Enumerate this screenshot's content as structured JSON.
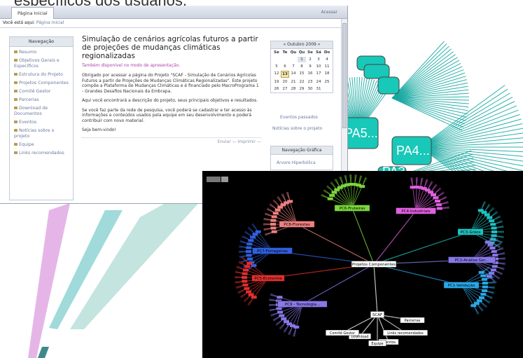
{
  "slide": {
    "title_fragment": "específicos dos usuários."
  },
  "background": {
    "page_labels": [
      "PA5...",
      "PA4...",
      "PA3"
    ]
  },
  "browser": {
    "tab_label": "Página Inicial",
    "access_link": "Acessar",
    "breadcrumb_prefix": "Você está aqui:",
    "breadcrumb_link": "Página Inicial"
  },
  "navigation": {
    "heading": "Navegação",
    "items": [
      {
        "label": "Resumo"
      },
      {
        "label": "Objetivos Gerais e Específicos"
      },
      {
        "label": "Estrutura do Projeto"
      },
      {
        "label": "Projetos Componentes"
      },
      {
        "label": "Comitê Gestor"
      },
      {
        "label": "Parcerias"
      },
      {
        "label": "Download de Documentos"
      },
      {
        "label": "Eventos"
      },
      {
        "label": "Notícias sobre o projeto"
      },
      {
        "label": "Equipe"
      },
      {
        "label": "Links recomendados"
      }
    ]
  },
  "main": {
    "title": "Simulação de cenários agrícolas futuros a partir de projeções de mudanças climáticas regionalizadas",
    "alt_mode": "Também disponível no modo de apresentação.",
    "paragraphs": [
      "Obrigado por acessar a página do Projeto \"SCAF - Simulação de Cenários Agrícolas Futuros a partir de Projeções de Mudanças Climáticas Regionalizadas\". Este projeto compõe a Plataforma de Mudanças Climáticas e é financiado pelo MacroPrograma 1 - Grandes Desafios Nacionais da Embrapa.",
      "Aqui você encontrará a descrição do projeto, seus principais objetivos e resultados.",
      "Se você faz parte da rede de pesquisa, você poderá se cadastrar e ter acesso às informações e conteúdos usados pela equipe em seu desenvolvimento e poderá contribuir com novo material.",
      "Seja bem-vindo!"
    ],
    "send_label": "Enviar",
    "print_label": "Imprimir"
  },
  "calendar": {
    "prev": "«",
    "next": "»",
    "month_label": "Outubro 2009",
    "weekdays": [
      "Se",
      "Te",
      "Qu",
      "Qu",
      "Se",
      "Sá",
      "Do"
    ],
    "days": [
      "",
      "",
      "",
      "1",
      "2",
      "3",
      "4",
      "5",
      "6",
      "7",
      "8",
      "9",
      "10",
      "11",
      "12",
      "13",
      "14",
      "15",
      "16",
      "17",
      "18",
      "19",
      "20",
      "21",
      "22",
      "23",
      "24",
      "25",
      "26",
      "27",
      "28",
      "29",
      "30",
      "31",
      ""
    ],
    "today": "13",
    "past_events": "Eventos passados",
    "news_link": "Notícias sobre o projeto"
  },
  "graphic_nav": {
    "heading": "Navegação Gráfica",
    "link": "Árvore Hiperbólica"
  },
  "tree": {
    "root": "Projetos Componentes",
    "colors": {
      "red": "#e03030",
      "salmon": "#f08080",
      "green": "#7cd63c",
      "magenta": "#e060e0",
      "teal": "#20c0c0",
      "blue": "#3060e0",
      "violet": "#8878e8",
      "cyan": "#2aa8e8",
      "white": "#ffffff"
    },
    "nodes": [
      {
        "label": "PC8-Florestas",
        "color": "#f08080"
      },
      {
        "label": "PC6-Fruteiras",
        "color": "#7cd63c"
      },
      {
        "label": "PC4-Industriais",
        "color": "#e060e0"
      },
      {
        "label": "PC3-Grãos",
        "color": "#20c0c0"
      },
      {
        "label": "PC7-Forrageiras",
        "color": "#3060e0"
      },
      {
        "label": "PC2-Análise Ger...",
        "color": "#8878e8"
      },
      {
        "label": "PC5-Economia",
        "color": "#e03030"
      },
      {
        "label": "PC1-Validação",
        "color": "#2aa8e8"
      },
      {
        "label": "PC9 - Tecnologia...",
        "color": "#8878e8"
      },
      {
        "label": "SCAF",
        "color": "#ffffff"
      }
    ],
    "scaf_children": [
      "Parcerias",
      "Links recomendados",
      "Eventos",
      "Equipe",
      "Download",
      "Comitê Gestor"
    ]
  }
}
